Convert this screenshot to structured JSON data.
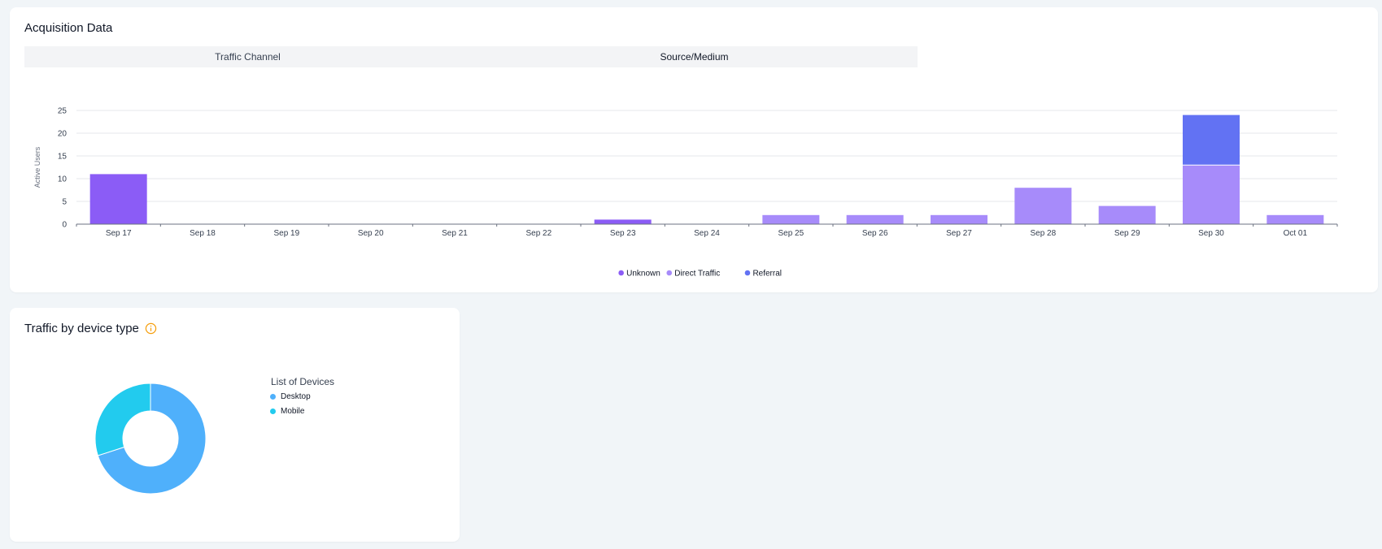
{
  "acquisition": {
    "title": "Acquisition Data",
    "tabs": [
      {
        "label": "Traffic Channel",
        "active": false
      },
      {
        "label": "Source/Medium",
        "active": true
      }
    ]
  },
  "chart_data": [
    {
      "type": "bar",
      "stacked": true,
      "ylabel": "Active Users",
      "xlabel": "",
      "ylim": [
        0,
        25
      ],
      "yticks": [
        0,
        5,
        10,
        15,
        20,
        25
      ],
      "grid": true,
      "legend_position": "bottom",
      "categories": [
        "Sep 17",
        "Sep 18",
        "Sep 19",
        "Sep 20",
        "Sep 21",
        "Sep 22",
        "Sep 23",
        "Sep 24",
        "Sep 25",
        "Sep 26",
        "Sep 27",
        "Sep 28",
        "Sep 29",
        "Sep 30",
        "Oct 01"
      ],
      "series": [
        {
          "name": "Unknown",
          "color": "#8b5cf6",
          "values": [
            11,
            0,
            0,
            0,
            0,
            0,
            1,
            0,
            0,
            0,
            0,
            0,
            0,
            0,
            0
          ]
        },
        {
          "name": "Direct Traffic",
          "color": "#a78bfa",
          "values": [
            0,
            0,
            0,
            0,
            0,
            0,
            0,
            0,
            2,
            2,
            2,
            8,
            4,
            13,
            2
          ]
        },
        {
          "name": "Referral",
          "color": "#6272f3",
          "values": [
            0,
            0,
            0,
            0,
            0,
            0,
            0,
            0,
            0,
            0,
            0,
            0,
            0,
            11,
            0
          ]
        }
      ]
    },
    {
      "type": "pie",
      "donut": true,
      "title": "List of Devices",
      "slices": [
        {
          "label": "Desktop",
          "value": 70,
          "color": "#4fb0fb"
        },
        {
          "label": "Mobile",
          "value": 30,
          "color": "#22cbee"
        }
      ]
    }
  ],
  "devices": {
    "title": "Traffic by device type",
    "info_icon": "info-circle-icon",
    "info_color": "#f59e0b"
  }
}
